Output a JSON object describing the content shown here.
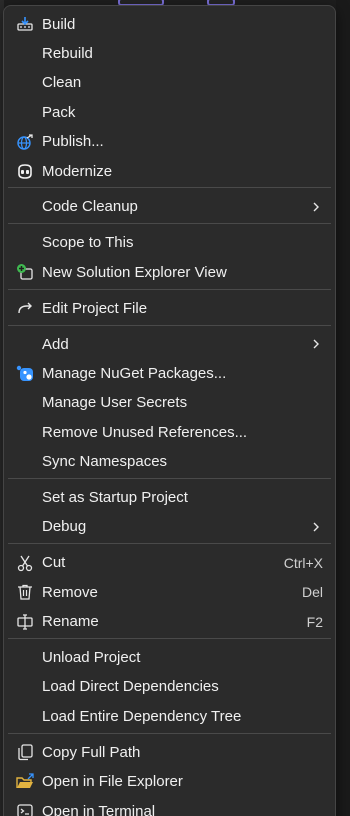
{
  "menu": {
    "groups": [
      [
        {
          "label": "Build",
          "icon": "build-icon"
        },
        {
          "label": "Rebuild"
        },
        {
          "label": "Clean"
        },
        {
          "label": "Pack"
        },
        {
          "label": "Publish...",
          "icon": "globe-publish-icon"
        },
        {
          "label": "Modernize",
          "icon": "copilot-icon"
        }
      ],
      [
        {
          "label": "Code Cleanup",
          "submenu": true
        }
      ],
      [
        {
          "label": "Scope to This"
        },
        {
          "label": "New Solution Explorer View",
          "icon": "new-view-icon"
        }
      ],
      [
        {
          "label": "Edit Project File",
          "icon": "redirect-arrow-icon"
        }
      ],
      [
        {
          "label": "Add",
          "submenu": true
        },
        {
          "label": "Manage NuGet Packages...",
          "icon": "nuget-icon"
        },
        {
          "label": "Manage User Secrets"
        },
        {
          "label": "Remove Unused References..."
        },
        {
          "label": "Sync Namespaces"
        }
      ],
      [
        {
          "label": "Set as Startup Project"
        },
        {
          "label": "Debug",
          "submenu": true
        }
      ],
      [
        {
          "label": "Cut",
          "icon": "scissors-icon",
          "shortcut": "Ctrl+X"
        },
        {
          "label": "Remove",
          "icon": "trash-icon",
          "shortcut": "Del"
        },
        {
          "label": "Rename",
          "icon": "rename-icon",
          "shortcut": "F2"
        }
      ],
      [
        {
          "label": "Unload Project"
        },
        {
          "label": "Load Direct Dependencies"
        },
        {
          "label": "Load Entire Dependency Tree"
        }
      ],
      [
        {
          "label": "Copy Full Path",
          "icon": "copy-icon"
        },
        {
          "label": "Open in File Explorer",
          "icon": "folder-open-icon"
        },
        {
          "label": "Open in Terminal",
          "icon": "terminal-icon"
        }
      ]
    ]
  },
  "colors": {
    "menu_bg": "#2b2b2b",
    "text": "#f0f0f0",
    "separator": "#4a4a4a",
    "accent_purple": "#7a6fd6",
    "green": "#3fb950",
    "blue": "#3794ff"
  }
}
